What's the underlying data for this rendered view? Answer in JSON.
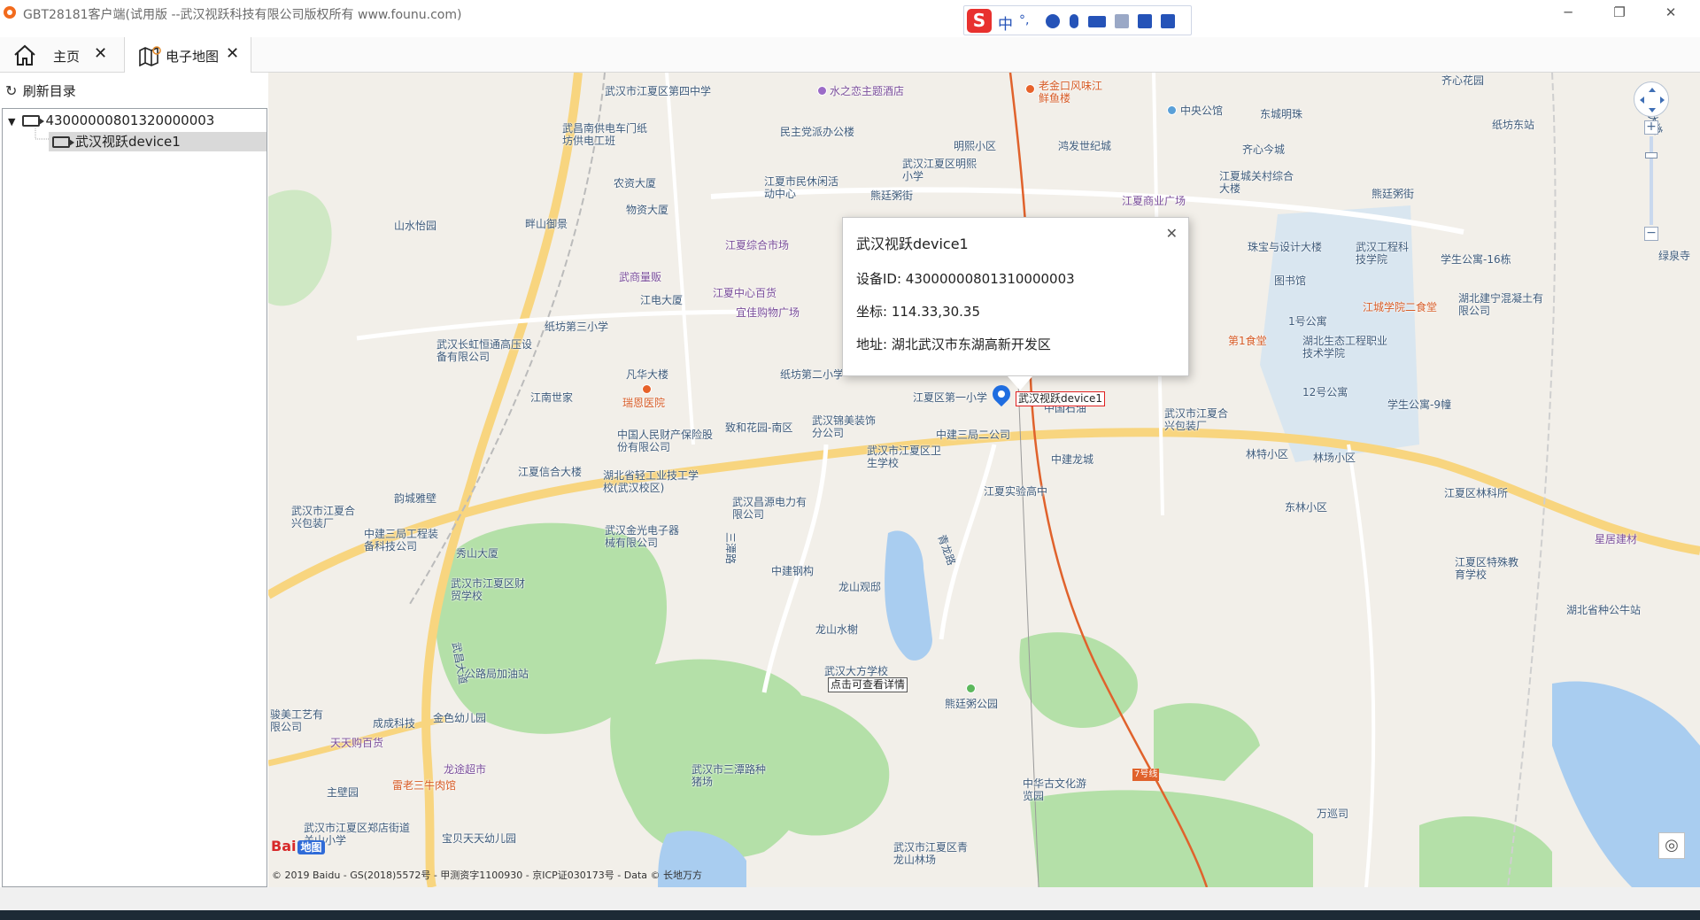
{
  "window": {
    "title": "GBT28181客户端(试用版 --武汉视跃科技有限公司版权所有 www.founu.com)",
    "minimize_glyph": "─",
    "restore_glyph": "❐",
    "close_glyph": "✕"
  },
  "ime": {
    "logo": "S",
    "mode": "中",
    "punct": "°,",
    "icons": [
      "smile-icon",
      "mic-icon",
      "keyboard-icon",
      "user-icon",
      "shirt-icon",
      "apps-icon"
    ]
  },
  "tabs": [
    {
      "label": "主页",
      "icon": "home-icon",
      "close": "✕"
    },
    {
      "label": "电子地图",
      "icon": "map-icon",
      "close": "✕"
    }
  ],
  "sidebar": {
    "refresh_label": "刷新目录",
    "tree": [
      {
        "label": "43000000801320000003",
        "expanded": true
      },
      {
        "label": "武汉视跃device1",
        "selected": true
      }
    ]
  },
  "map": {
    "popup": {
      "title": "武汉视跃device1",
      "device_id": "设备ID: 43000000801310000003",
      "coords": "坐标: 114.33,30.35",
      "address": "地址: 湖北武汉市东湖高新开发区",
      "close": "✕"
    },
    "marker_label": "武汉视跃device1",
    "hover_hint": "点击可查看详情",
    "zoom_in": "+",
    "zoom_out": "−",
    "locate_glyph": "◎",
    "logo_text": "Bai",
    "logo_map": "地图",
    "copyright": "© 2019 Baidu - GS(2018)5572号 - 甲测资字1100930 - 京ICP证030173号 - Data © 长地万方",
    "pois": [
      {
        "t": "武汉市江夏区第四中学",
        "c": ""
      },
      {
        "t": "水之恋主题酒店",
        "c": "purple"
      },
      {
        "t": "老金口风味江鲜鱼楼",
        "c": "red"
      },
      {
        "t": "中央公馆",
        "c": ""
      },
      {
        "t": "东城明珠",
        "c": ""
      },
      {
        "t": "齐心花园",
        "c": ""
      },
      {
        "t": "纸坊东站",
        "c": ""
      },
      {
        "t": "武昌南供电车门纸坊供电工班",
        "c": ""
      },
      {
        "t": "民主党派办公楼",
        "c": ""
      },
      {
        "t": "明熙小区",
        "c": ""
      },
      {
        "t": "鸿发世纪城",
        "c": ""
      },
      {
        "t": "齐心今城",
        "c": ""
      },
      {
        "t": "农资大厦",
        "c": ""
      },
      {
        "t": "江夏市民休闲活动中心",
        "c": ""
      },
      {
        "t": "武汉江夏区明熙小学",
        "c": ""
      },
      {
        "t": "江夏城关村综合大楼",
        "c": ""
      },
      {
        "t": "熊廷粥街",
        "c": ""
      },
      {
        "t": "物资大厦",
        "c": ""
      },
      {
        "t": "江夏商业广场",
        "c": "purple"
      },
      {
        "t": "山水怡园",
        "c": ""
      },
      {
        "t": "畔山御景",
        "c": ""
      },
      {
        "t": "江夏综合市场",
        "c": "purple"
      },
      {
        "t": "珠宝与设计大楼",
        "c": ""
      },
      {
        "t": "武汉工程科技学院",
        "c": ""
      },
      {
        "t": "学生公寓-16栋",
        "c": ""
      },
      {
        "t": "武商量贩",
        "c": "purple"
      },
      {
        "t": "图书馆",
        "c": ""
      },
      {
        "t": "绿泉寺",
        "c": ""
      },
      {
        "t": "江电大厦",
        "c": ""
      },
      {
        "t": "江夏中心百货",
        "c": "purple"
      },
      {
        "t": "宜佳购物广场",
        "c": "purple"
      },
      {
        "t": "纸坊第三小学",
        "c": ""
      },
      {
        "t": "湖北建宁混凝土有限公司",
        "c": ""
      },
      {
        "t": "江城学院二食堂",
        "c": "red"
      },
      {
        "t": "1号公寓",
        "c": ""
      },
      {
        "t": "武汉长虹恒通高压设备有限公司",
        "c": ""
      },
      {
        "t": "第1食堂",
        "c": "red"
      },
      {
        "t": "湖北生态工程职业技术学院",
        "c": ""
      },
      {
        "t": "凡华大楼",
        "c": ""
      },
      {
        "t": "纸坊第二小学",
        "c": ""
      },
      {
        "t": "江南世家",
        "c": ""
      },
      {
        "t": "瑞恩医院",
        "c": "red"
      },
      {
        "t": "江夏区第一小学",
        "c": ""
      },
      {
        "t": "中国石油",
        "c": ""
      },
      {
        "t": "12号公寓",
        "c": ""
      },
      {
        "t": "学生公寓-9幢",
        "c": ""
      },
      {
        "t": "致和花园-南区",
        "c": ""
      },
      {
        "t": "武汉锦美装饰分公司",
        "c": ""
      },
      {
        "t": "中国人民财产保险股份有限公司",
        "c": ""
      },
      {
        "t": "中建三局二公司",
        "c": ""
      },
      {
        "t": "武汉市江夏合兴包装厂",
        "c": ""
      },
      {
        "t": "林特小区",
        "c": ""
      },
      {
        "t": "林场小区",
        "c": ""
      },
      {
        "t": "武汉市江夏区卫生学校",
        "c": ""
      },
      {
        "t": "中建龙城",
        "c": ""
      },
      {
        "t": "江夏信合大楼",
        "c": ""
      },
      {
        "t": "湖北省轻工业技工学校(武汉校区)",
        "c": ""
      },
      {
        "t": "江夏实验高中",
        "c": ""
      },
      {
        "t": "东林小区",
        "c": ""
      },
      {
        "t": "江夏区林科所",
        "c": ""
      },
      {
        "t": "韵城雅壁",
        "c": ""
      },
      {
        "t": "武汉市江夏合兴包装厂",
        "c": ""
      },
      {
        "t": "武汉昌源电力有限公司",
        "c": ""
      },
      {
        "t": "中建三局工程装备科技公司",
        "c": ""
      },
      {
        "t": "武汉金光电子器械有限公司",
        "c": ""
      },
      {
        "t": "星居建材",
        "c": "purple"
      },
      {
        "t": "秀山大厦",
        "c": ""
      },
      {
        "t": "中建钢构",
        "c": ""
      },
      {
        "t": "江夏区特殊教育学校",
        "c": ""
      },
      {
        "t": "武汉市江夏区财贸学校",
        "c": ""
      },
      {
        "t": "龙山观邸",
        "c": ""
      },
      {
        "t": "湖北省种公牛站",
        "c": ""
      },
      {
        "t": "龙山水榭",
        "c": ""
      },
      {
        "t": "公路局加油站",
        "c": ""
      },
      {
        "t": "武汉大方学校",
        "c": ""
      },
      {
        "t": "熊廷粥公园",
        "c": ""
      },
      {
        "t": "骏美工艺有限公司",
        "c": ""
      },
      {
        "t": "成成科技",
        "c": ""
      },
      {
        "t": "金色幼儿园",
        "c": ""
      },
      {
        "t": "天天购百货",
        "c": "purple"
      },
      {
        "t": "龙途超市",
        "c": "purple"
      },
      {
        "t": "武汉市三潭路种猪场",
        "c": ""
      },
      {
        "t": "中华古文化游览园",
        "c": ""
      },
      {
        "t": "雷老三牛肉馆",
        "c": "red"
      },
      {
        "t": "主壁园",
        "c": ""
      },
      {
        "t": "武汉市江夏区郑店街道关山小学",
        "c": ""
      },
      {
        "t": "宝贝天天幼儿园",
        "c": ""
      },
      {
        "t": "武汉市江夏区青龙山林场",
        "c": ""
      },
      {
        "t": "万巡司",
        "c": ""
      },
      {
        "t": "江南大道",
        "c": ""
      },
      {
        "t": "武昌大道",
        "c": ""
      },
      {
        "t": "三潭路",
        "c": ""
      },
      {
        "t": "青龙路",
        "c": ""
      },
      {
        "t": "熊廷粥街",
        "c": ""
      },
      {
        "t": "7号线",
        "c": ""
      }
    ]
  }
}
